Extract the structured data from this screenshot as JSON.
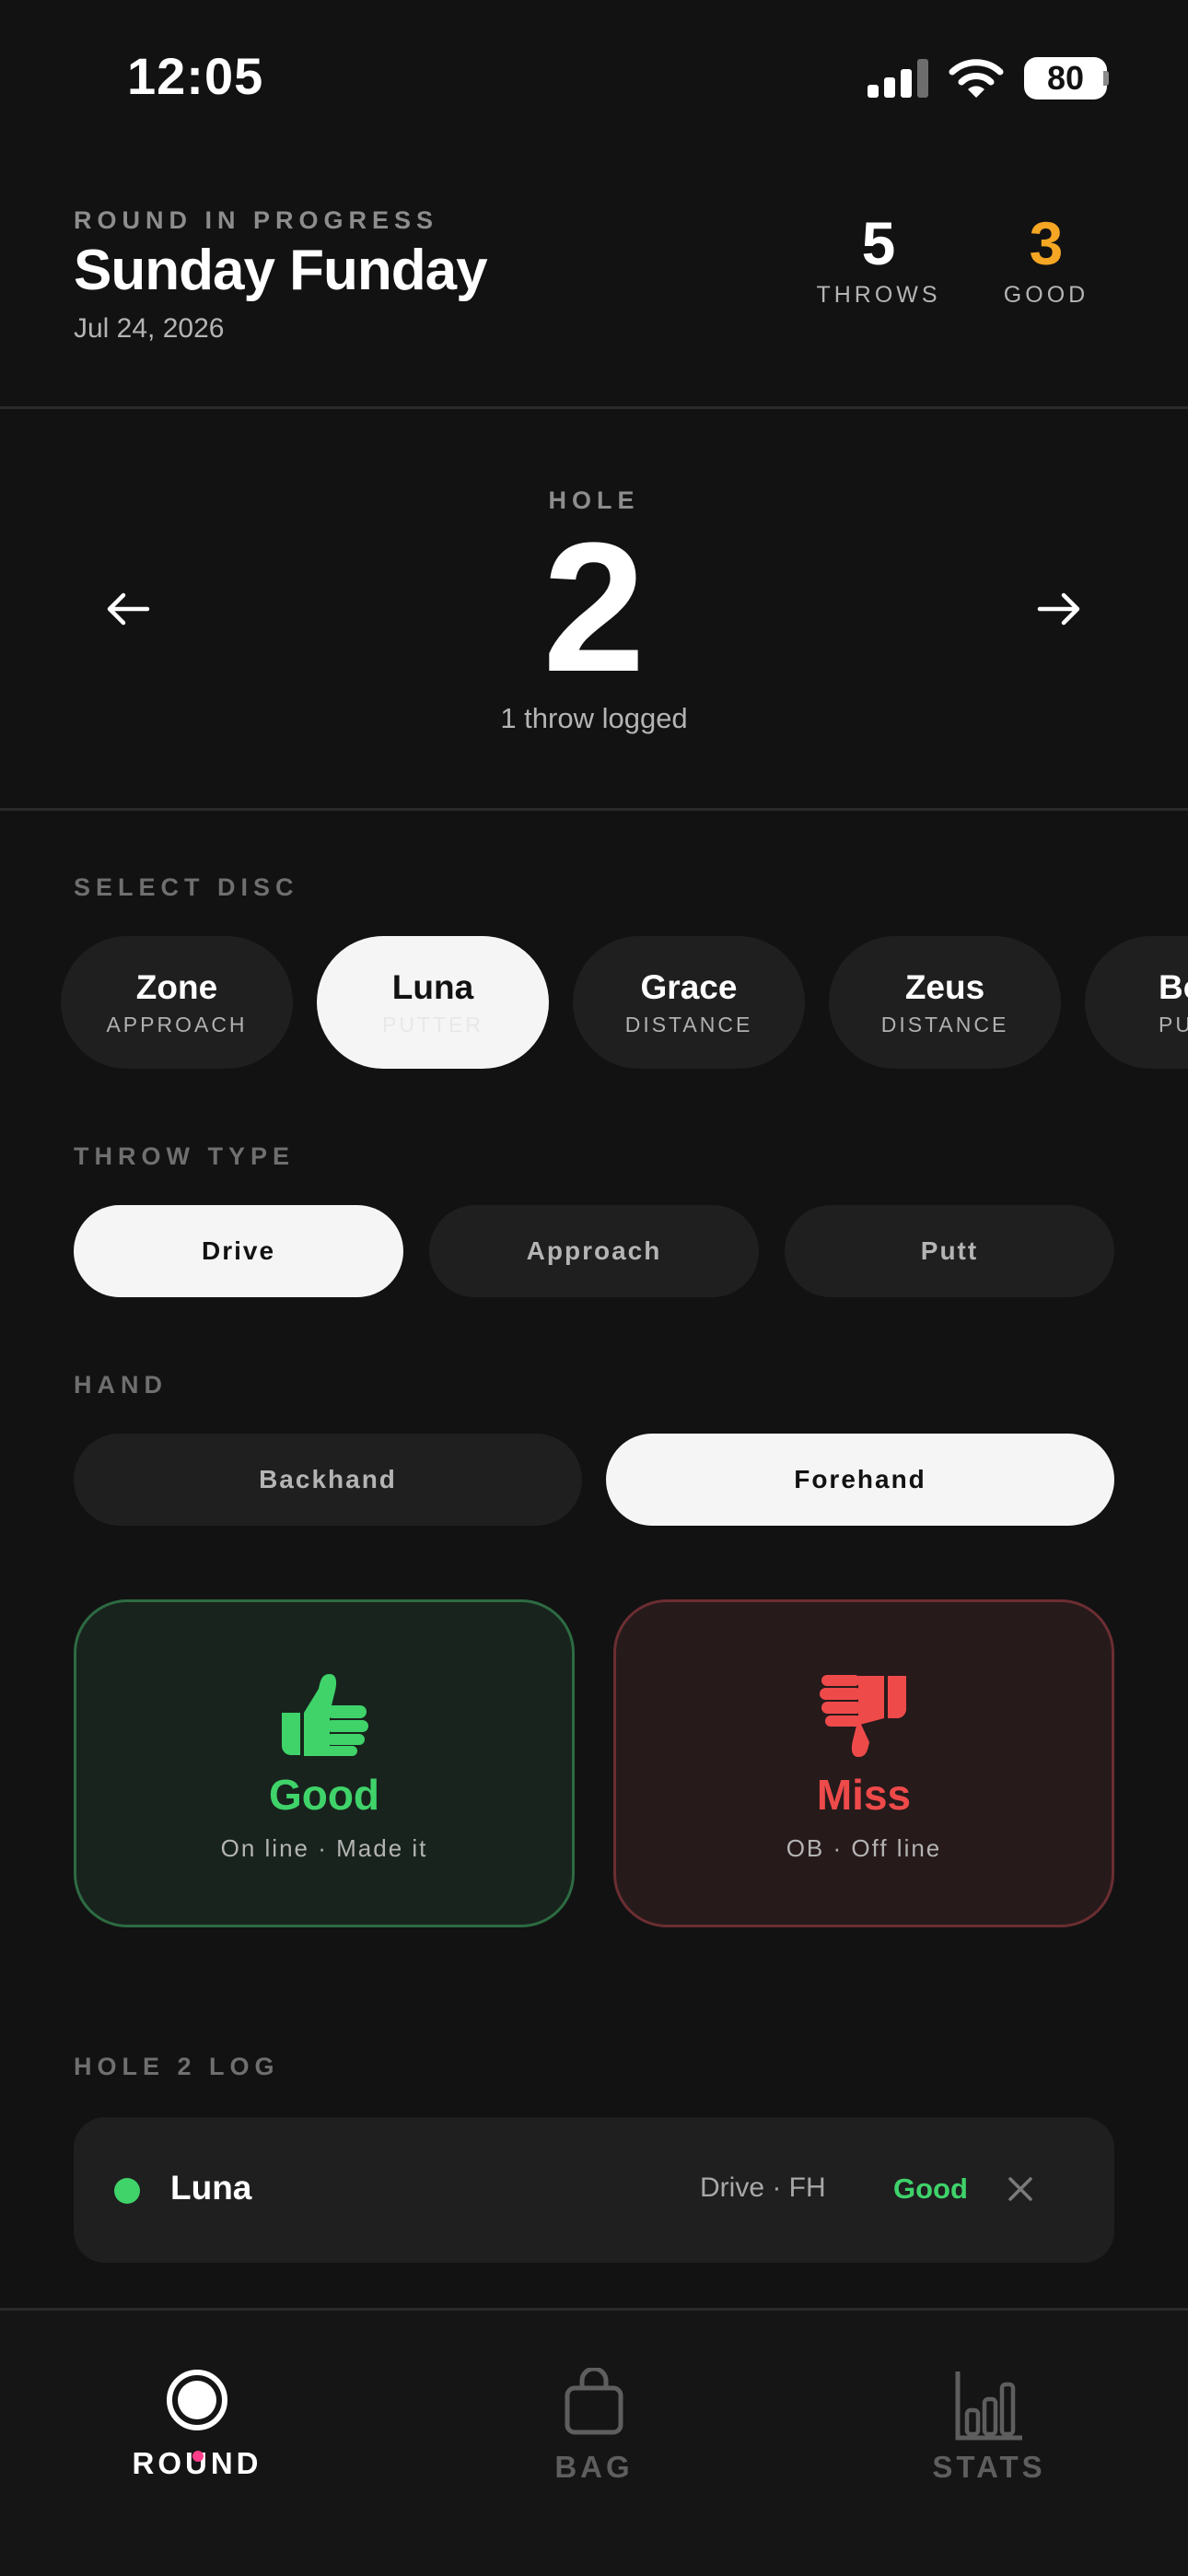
{
  "status_bar": {
    "time": "12:05",
    "battery": "80"
  },
  "header": {
    "eyebrow": "ROUND IN PROGRESS",
    "title": "Sunday Funday",
    "date": "Jul 24, 2026",
    "stats": [
      {
        "value": "5",
        "label": "THROWS",
        "color": "#ffffff"
      },
      {
        "value": "3",
        "label": "GOOD",
        "color": "#f5a623"
      }
    ]
  },
  "hole": {
    "label": "HOLE",
    "number": "2",
    "subtitle": "1 throw logged"
  },
  "discs": {
    "label": "SELECT DISC",
    "items": [
      {
        "name": "Zone",
        "type": "APPROACH",
        "selected": false
      },
      {
        "name": "Luna",
        "type": "PUTTER",
        "selected": true
      },
      {
        "name": "Grace",
        "type": "DISTANCE",
        "selected": false
      },
      {
        "name": "Zeus",
        "type": "DISTANCE",
        "selected": false
      },
      {
        "name": "Bo",
        "type": "PU",
        "selected": false
      }
    ]
  },
  "throw_type": {
    "label": "THROW TYPE",
    "options": [
      "Drive",
      "Approach",
      "Putt"
    ],
    "selected": "Drive"
  },
  "hand": {
    "label": "HAND",
    "options": [
      "Backhand",
      "Forehand"
    ],
    "selected": "Forehand"
  },
  "outcomes": {
    "good": {
      "title": "Good",
      "subtitle": "On line · Made it",
      "color": "#3fd36a",
      "icon": "thumbs-up-icon"
    },
    "miss": {
      "title": "Miss",
      "subtitle": "OB · Off line",
      "color": "#ef4a4a",
      "icon": "thumbs-down-icon"
    }
  },
  "log": {
    "label": "HOLE 2 LOG",
    "entries": [
      {
        "disc": "Luna",
        "meta": "Drive · FH",
        "result": "Good"
      }
    ]
  },
  "tabs": [
    {
      "label": "ROUND",
      "icon": "round-icon",
      "active": true
    },
    {
      "label": "BAG",
      "icon": "bag-icon",
      "active": false
    },
    {
      "label": "STATS",
      "icon": "stats-icon",
      "active": false
    }
  ]
}
